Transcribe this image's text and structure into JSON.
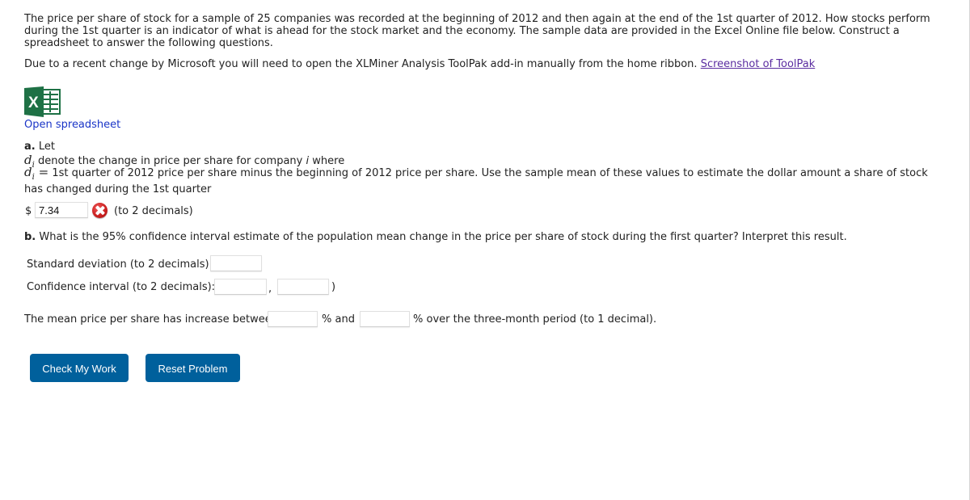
{
  "intro": {
    "paragraph": "The price per share of stock for a sample of 25 companies was recorded at the beginning of 2012 and then again at the end of the 1st quarter of 2012. How stocks perform during the 1st quarter is an indicator of what is ahead for the stock market and the economy. The sample data are provided in the Excel Online file below. Construct a spreadsheet to answer the following questions.",
    "notice": "Due to a recent change by Microsoft you will need to open the XLMiner Analysis ToolPak add-in manually from the home ribbon.",
    "notice_link": "Screenshot of ToolPak"
  },
  "spreadsheet": {
    "icon": "excel-icon",
    "icon_letter": "X",
    "link_label": "Open spreadsheet",
    "colors": {
      "excel_green": "#1e7145",
      "link_blue": "#1a35c7"
    }
  },
  "part_a": {
    "label": "a.",
    "lead": "Let",
    "var": "d",
    "sub": "i",
    "line1": "denote the change in price per share for company",
    "line1_italic": "i",
    "line1_end": "where",
    "equals": "=",
    "line2": "1st quarter of 2012 price per share minus the beginning of 2012 price per share. Use the sample mean of these values to estimate the dollar amount a share of stock has changed during the 1st quarter",
    "currency": "$",
    "answer_value": "7.34",
    "status_icon": "incorrect-x-icon",
    "hint": "(to 2 decimals)"
  },
  "part_b": {
    "label": "b.",
    "question": "What is the 95% confidence interval estimate of the population mean change in the price per share of stock during the first quarter? Interpret this result.",
    "std_label": "Standard deviation (to 2 decimals):",
    "std_value": "",
    "ci_label": "Confidence interval (to 2 decimals): (",
    "ci_comma": ",",
    "ci_close": ")",
    "ci_low": "",
    "ci_high": "",
    "interp_start": "The mean price per share has increase between",
    "interp_mid": "% and",
    "interp_end": "% over the three-month period (to 1 decimal).",
    "pct_low": "",
    "pct_high": ""
  },
  "buttons": {
    "check": "Check My Work",
    "reset": "Reset Problem",
    "color": "#00609c"
  }
}
